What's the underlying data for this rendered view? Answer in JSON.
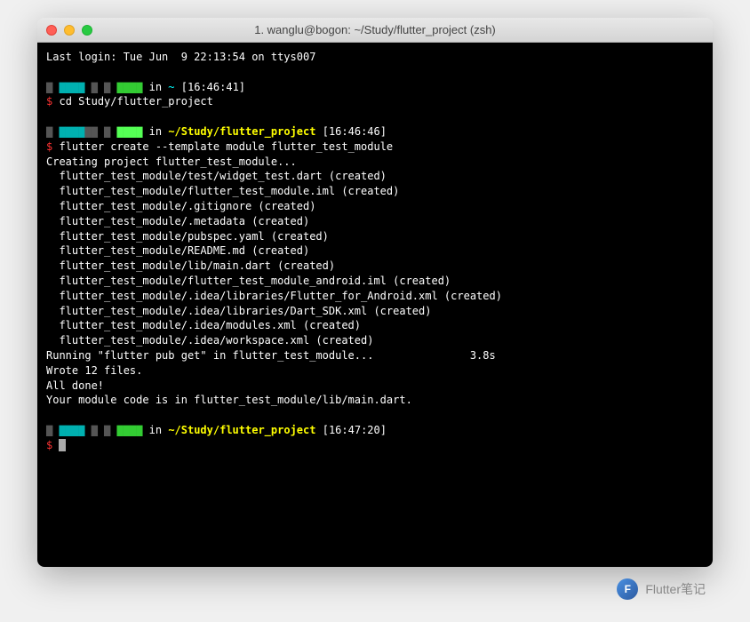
{
  "window": {
    "title": "1. wanglu@bogon: ~/Study/flutter_project (zsh)"
  },
  "terminal": {
    "last_login": "Last login: Tue Jun  9 22:13:54 on ttys007",
    "prompt1": {
      "in": "in",
      "path": "~",
      "time": "[16:46:41]"
    },
    "cmd1": {
      "dollar": "$",
      "text": "cd Study/flutter_project"
    },
    "prompt2": {
      "in": "in",
      "path": "~/Study/flutter_project",
      "time": "[16:46:46]"
    },
    "cmd2": {
      "dollar": "$",
      "text": "flutter create --template module flutter_test_module"
    },
    "output": [
      "Creating project flutter_test_module...",
      "  flutter_test_module/test/widget_test.dart (created)",
      "  flutter_test_module/flutter_test_module.iml (created)",
      "  flutter_test_module/.gitignore (created)",
      "  flutter_test_module/.metadata (created)",
      "  flutter_test_module/pubspec.yaml (created)",
      "  flutter_test_module/README.md (created)",
      "  flutter_test_module/lib/main.dart (created)",
      "  flutter_test_module/flutter_test_module_android.iml (created)",
      "  flutter_test_module/.idea/libraries/Flutter_for_Android.xml (created)",
      "  flutter_test_module/.idea/libraries/Dart_SDK.xml (created)",
      "  flutter_test_module/.idea/modules.xml (created)",
      "  flutter_test_module/.idea/workspace.xml (created)",
      "Running \"flutter pub get\" in flutter_test_module...               3.8s",
      "Wrote 12 files.",
      "",
      "All done!",
      "Your module code is in flutter_test_module/lib/main.dart."
    ],
    "prompt3": {
      "in": "in",
      "path": "~/Study/flutter_project",
      "time": "[16:47:20]"
    },
    "cmd3": {
      "dollar": "$"
    }
  },
  "watermark": {
    "text": "Flutter笔记",
    "icon": "F"
  }
}
